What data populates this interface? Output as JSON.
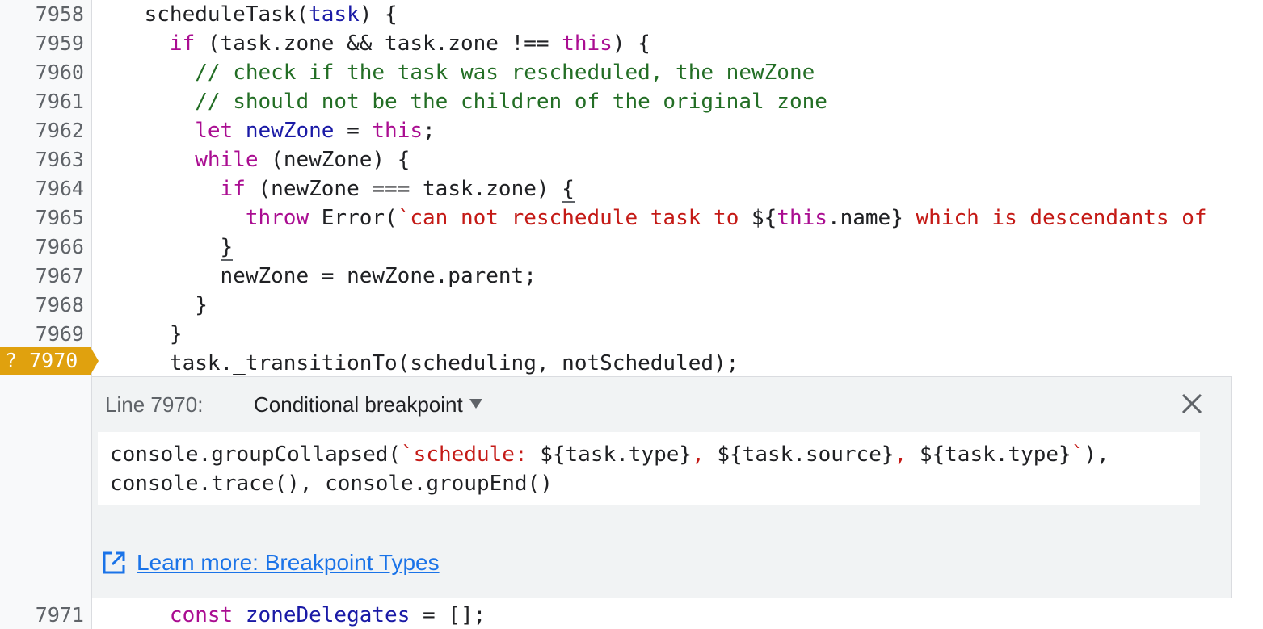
{
  "editor": {
    "lines": [
      {
        "n": "7958",
        "tokens": [
          [
            "plain",
            "    scheduleTask("
          ],
          [
            "var",
            "task"
          ],
          [
            "plain",
            ") {"
          ]
        ]
      },
      {
        "n": "7959",
        "tokens": [
          [
            "plain",
            "      "
          ],
          [
            "kw",
            "if"
          ],
          [
            "plain",
            " (task.zone && task.zone !== "
          ],
          [
            "kw",
            "this"
          ],
          [
            "plain",
            ") {"
          ]
        ]
      },
      {
        "n": "7960",
        "tokens": [
          [
            "plain",
            "        "
          ],
          [
            "cm",
            "// check if the task was rescheduled, the newZone"
          ]
        ]
      },
      {
        "n": "7961",
        "tokens": [
          [
            "plain",
            "        "
          ],
          [
            "cm",
            "// should not be the children of the original zone"
          ]
        ]
      },
      {
        "n": "7962",
        "tokens": [
          [
            "plain",
            "        "
          ],
          [
            "kw",
            "let"
          ],
          [
            "plain",
            " "
          ],
          [
            "var",
            "newZone"
          ],
          [
            "plain",
            " = "
          ],
          [
            "kw",
            "this"
          ],
          [
            "plain",
            ";"
          ]
        ]
      },
      {
        "n": "7963",
        "tokens": [
          [
            "plain",
            "        "
          ],
          [
            "kw",
            "while"
          ],
          [
            "plain",
            " (newZone) {"
          ]
        ]
      },
      {
        "n": "7964",
        "tokens": [
          [
            "plain",
            "          "
          ],
          [
            "kw",
            "if"
          ],
          [
            "plain",
            " (newZone === task.zone) "
          ],
          [
            "brace",
            "{"
          ]
        ]
      },
      {
        "n": "7965",
        "tokens": [
          [
            "plain",
            "            "
          ],
          [
            "kw",
            "throw"
          ],
          [
            "plain",
            " Error("
          ],
          [
            "str",
            "`can not reschedule task to "
          ],
          [
            "plain",
            "${"
          ],
          [
            "kw",
            "this"
          ],
          [
            "plain",
            ".name}"
          ],
          [
            "str",
            " which is descendants of"
          ]
        ]
      },
      {
        "n": "7966",
        "tokens": [
          [
            "plain",
            "          "
          ],
          [
            "brace",
            "}"
          ]
        ]
      },
      {
        "n": "7967",
        "tokens": [
          [
            "plain",
            "          newZone = newZone.parent;"
          ]
        ]
      },
      {
        "n": "7968",
        "tokens": [
          [
            "plain",
            "        }"
          ]
        ]
      },
      {
        "n": "7969",
        "tokens": [
          [
            "plain",
            "      }"
          ]
        ]
      },
      {
        "n": "7970",
        "tokens": [
          [
            "plain",
            "      task._transitionTo(scheduling, notScheduled);"
          ]
        ]
      }
    ],
    "after_line": {
      "n": "7971",
      "tokens": [
        [
          "plain",
          "      "
        ],
        [
          "kw",
          "const"
        ],
        [
          "plain",
          " "
        ],
        [
          "var",
          "zoneDelegates"
        ],
        [
          "plain",
          " = [];"
        ]
      ]
    }
  },
  "breakpoint_marker": {
    "label": "? 7970",
    "color": "#e0a10e"
  },
  "breakpoint_panel": {
    "line_label": "Line 7970:",
    "type_label": "Conditional breakpoint",
    "close_icon": "close-icon",
    "condition_lines": [
      [
        [
          "plain",
          "console.groupCollapsed("
        ],
        [
          "str",
          "`schedule: "
        ],
        [
          "plain",
          "${task.type}"
        ],
        [
          "str",
          ", "
        ],
        [
          "plain",
          "${task.source}"
        ],
        [
          "str",
          ", "
        ],
        [
          "plain",
          "${task.type}"
        ],
        [
          "str",
          "`"
        ],
        [
          "plain",
          "),"
        ]
      ],
      [
        [
          "plain",
          "console.trace(), console.groupEnd()"
        ]
      ]
    ],
    "learn_more_icon": "external-link-icon",
    "learn_more_text": "Learn more: Breakpoint Types"
  },
  "colors": {
    "keyword": "#aa0d91",
    "variable": "#1a1aa6",
    "comment": "#236e25",
    "string": "#c41a16",
    "link": "#1a73e8",
    "breakpoint": "#e0a10e"
  }
}
